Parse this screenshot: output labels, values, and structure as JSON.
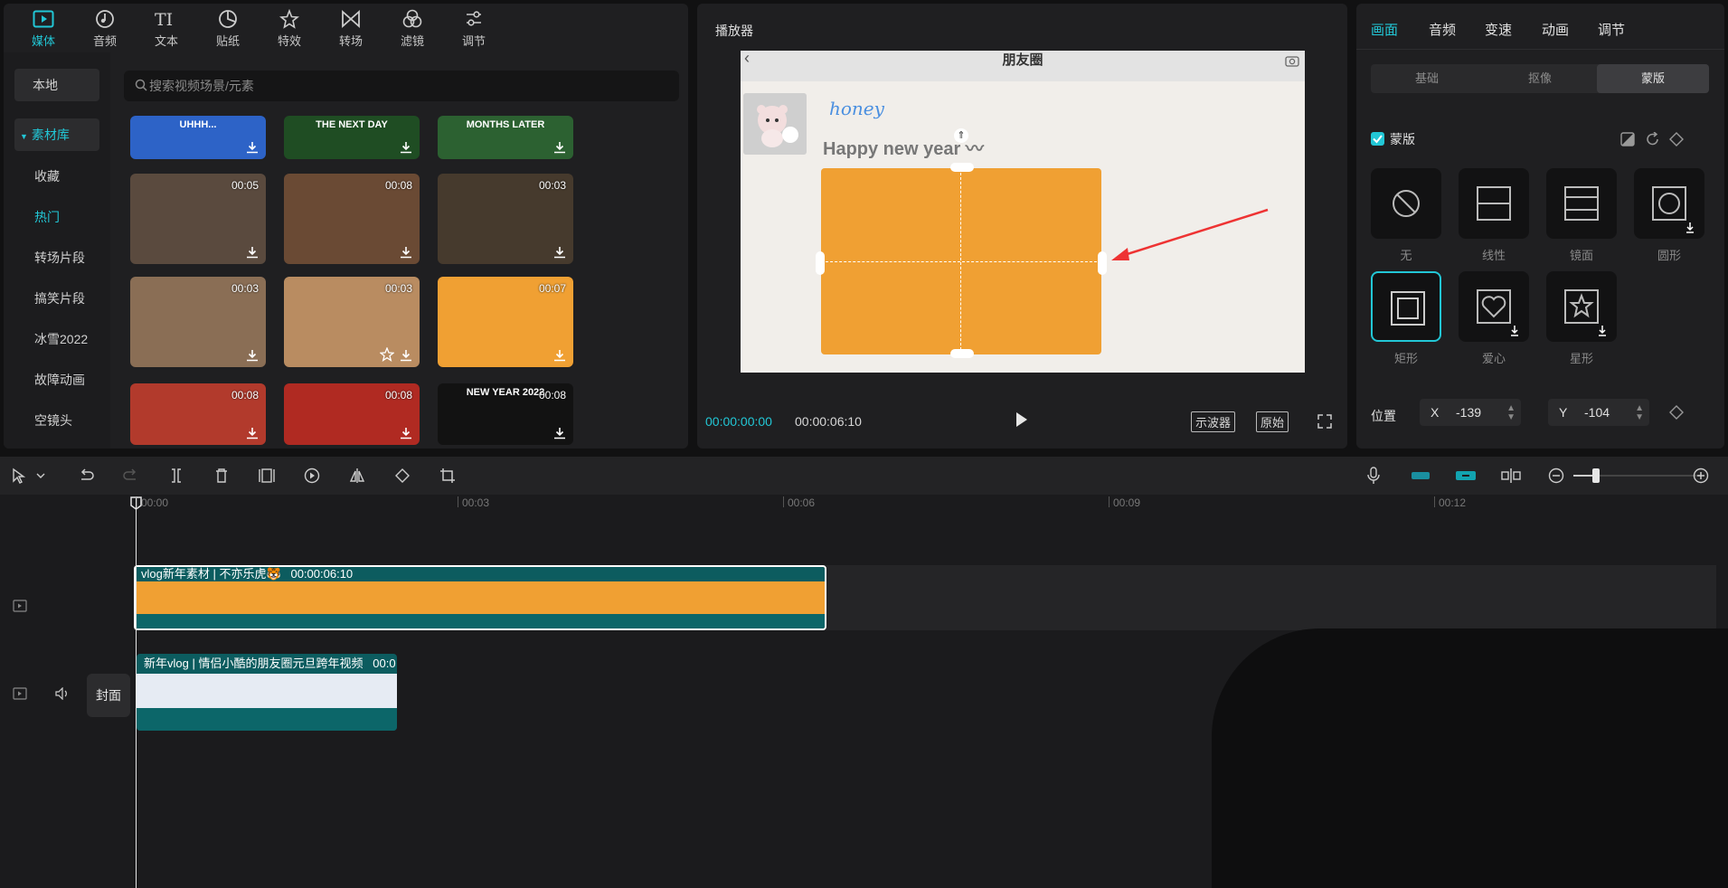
{
  "media_panel": {
    "tabs": [
      {
        "label": "媒体",
        "icon": "media-icon",
        "active": true
      },
      {
        "label": "音频",
        "icon": "audio-icon"
      },
      {
        "label": "文本",
        "icon": "text-icon"
      },
      {
        "label": "贴纸",
        "icon": "sticker-icon"
      },
      {
        "label": "特效",
        "icon": "effects-icon"
      },
      {
        "label": "转场",
        "icon": "transition-icon"
      },
      {
        "label": "滤镜",
        "icon": "filter-icon"
      },
      {
        "label": "调节",
        "icon": "adjust-icon"
      }
    ],
    "sidebar": [
      {
        "label": "本地"
      },
      {
        "label": "素材库",
        "expanded": true
      },
      {
        "label": "收藏"
      },
      {
        "label": "热门",
        "active": true
      },
      {
        "label": "转场片段"
      },
      {
        "label": "搞笑片段"
      },
      {
        "label": "冰雪2022"
      },
      {
        "label": "故障动画"
      },
      {
        "label": "空镜头"
      }
    ],
    "search_placeholder": "搜索视频场景/元素",
    "thumbnails": [
      {
        "text": "UHHH...",
        "duration": "",
        "color": "#2d63c7"
      },
      {
        "text": "THE NEXT DAY",
        "duration": "",
        "color": "#1f4d23"
      },
      {
        "text": "MONTHS LATER",
        "duration": "",
        "color": "#2c6131"
      },
      {
        "text": "",
        "duration": "00:05",
        "color": "#5a4a3e"
      },
      {
        "text": "",
        "duration": "00:08",
        "color": "#6a4a34"
      },
      {
        "text": "",
        "duration": "00:03",
        "color": "#463a2d"
      },
      {
        "text": "",
        "duration": "00:03",
        "color": "#8a6e55"
      },
      {
        "text": "",
        "duration": "00:03",
        "color": "#b98c61"
      },
      {
        "text": "",
        "duration": "00:07",
        "color": "#f0a033"
      },
      {
        "text": "",
        "duration": "00:08",
        "color": "#b23a2c"
      },
      {
        "text": "",
        "duration": "00:08",
        "color": "#b02a22"
      },
      {
        "text": "NEW YEAR 2022",
        "duration": "00:08",
        "color": "#121212"
      }
    ]
  },
  "player": {
    "title": "播放器",
    "screen_title": "朋友圈",
    "post_name": "honey",
    "post_text": "Happy new year 〰",
    "time_current": "00:00:00:00",
    "time_total": "00:00:06:10",
    "btn_scope": "示波器",
    "btn_original": "原始"
  },
  "props": {
    "tabs": [
      {
        "label": "画面",
        "active": true
      },
      {
        "label": "音频"
      },
      {
        "label": "变速"
      },
      {
        "label": "动画"
      },
      {
        "label": "调节"
      }
    ],
    "segments": [
      {
        "label": "基础"
      },
      {
        "label": "抠像"
      },
      {
        "label": "蒙版",
        "active": true
      }
    ],
    "mask_label": "蒙版",
    "masks": [
      {
        "label": "无",
        "icon": "none-icon"
      },
      {
        "label": "线性",
        "icon": "linear-icon"
      },
      {
        "label": "镜面",
        "icon": "mirror-icon"
      },
      {
        "label": "圆形",
        "icon": "circle-icon"
      },
      {
        "label": "矩形",
        "icon": "rect-icon",
        "selected": true
      },
      {
        "label": "爱心",
        "icon": "heart-icon"
      },
      {
        "label": "星形",
        "icon": "star-icon"
      }
    ],
    "position_label": "位置",
    "x_label": "X",
    "x_value": "-139",
    "y_label": "Y",
    "y_value": "-104"
  },
  "timeline": {
    "ruler": [
      "00:00",
      "00:03",
      "00:06",
      "00:09",
      "00:12"
    ],
    "clip1_title": "vlog新年素材 | 不亦乐虎🐯",
    "clip1_duration": "00:00:06:10",
    "clip2_title": "新年vlog | 情侣小酷的朋友圈元旦跨年视频",
    "clip2_duration": "00:0",
    "cover_label": "封面"
  },
  "colors": {
    "accent": "#22c7d6",
    "panel": "#1f1f21",
    "orange": "#f0a033"
  }
}
